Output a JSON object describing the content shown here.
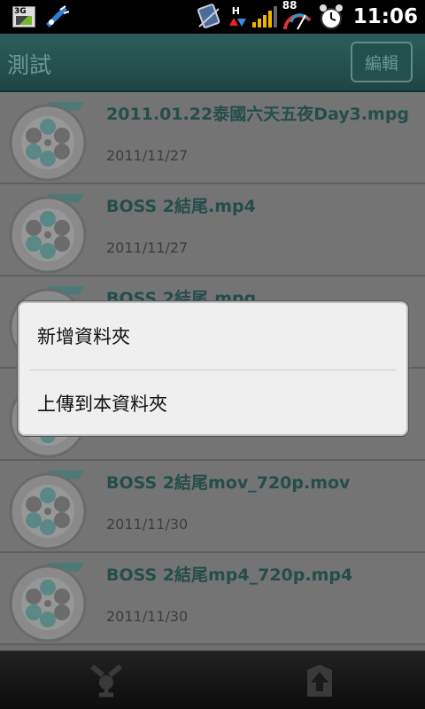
{
  "status_bar": {
    "network_label": "3G",
    "data_type_label": "H",
    "battery_level": "88",
    "time": "11:06",
    "icons": [
      "3g-data-icon",
      "usb-icon",
      "notification-icon",
      "hspa-transfer-icon",
      "signal-bars-icon",
      "battery-gauge-icon",
      "alarm-clock-icon"
    ]
  },
  "header": {
    "title": "測試",
    "edit_label": "編輯"
  },
  "files": [
    {
      "name": "2011.01.22泰國六天五夜Day3.mpg",
      "date": "2011/11/27"
    },
    {
      "name": "BOSS 2結尾.mp4",
      "date": "2011/11/27"
    },
    {
      "name": "BOSS 2結尾.mpg",
      "date": ""
    },
    {
      "name": "",
      "date": ""
    },
    {
      "name": "BOSS 2結尾mov_720p.mov",
      "date": "2011/11/30"
    },
    {
      "name": "BOSS 2結尾mp4_720p.mp4",
      "date": "2011/11/30"
    }
  ],
  "dialog": {
    "items": [
      "新增資料夾",
      "上傳到本資料夾"
    ]
  },
  "bottom_bar": {
    "icons": [
      "share-icon",
      "upload-icon"
    ]
  },
  "colors": {
    "accent": "#2d5e5b",
    "title_text": "#244e4c"
  }
}
